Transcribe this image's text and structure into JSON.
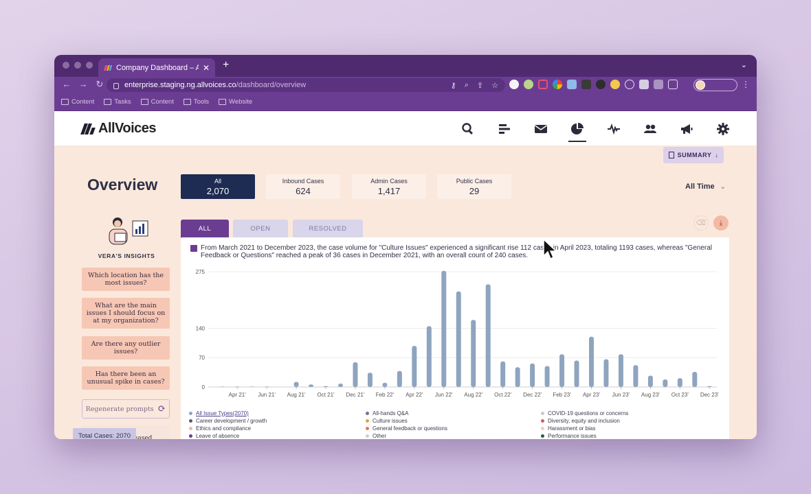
{
  "browser": {
    "tab_title": "Company Dashboard – AllVoices",
    "tab_close": "✕",
    "new_tab": "+",
    "url_host": "enterprise.staging.ng.allvoices.co",
    "url_path": "/dashboard/overview",
    "bookmarks": [
      "Content",
      "Tasks",
      "Content",
      "Tools",
      "Website"
    ]
  },
  "app": {
    "logo_text": "AllVoices",
    "summary_label": "SUMMARY",
    "page_title": "Overview",
    "stats": [
      {
        "label": "All",
        "value": "2,070"
      },
      {
        "label": "Inbound Cases",
        "value": "624"
      },
      {
        "label": "Admin Cases",
        "value": "1,417"
      },
      {
        "label": "Public Cases",
        "value": "29"
      }
    ],
    "time_filter": "All Time",
    "subtabs": [
      "ALL",
      "OPEN",
      "RESOLVED"
    ]
  },
  "insights": {
    "title": "VERA'S INSIGHTS",
    "prompts": [
      "Which location has the most issues?",
      "What are the main issues I should focus on at my organization?",
      "Are there any outlier issues?",
      "Has there been an unusual spike in cases?"
    ],
    "regenerate_label": "Regenerate prompts",
    "partial_prompt": "Has it decreased",
    "total_badge": "Total Cases: 2070"
  },
  "chart_panel": {
    "insight_text": "From March 2021 to December 2023, the case volume for \"Culture Issues\" experienced a significant rise 112 cases in April 2023, totaling 1193 cases, whereas \"General Feedback or Questions\" reached a peak of 36 cases in December 2021, with an overall count of 240 cases."
  },
  "chart_data": {
    "type": "bar",
    "ylim": [
      0,
      275
    ],
    "yticks": [
      0,
      70,
      140,
      275
    ],
    "x_tick_labels": [
      "Apr 21'",
      "Jun 21'",
      "Aug 21'",
      "Oct 21'",
      "Dec 21'",
      "Feb 22'",
      "Apr 22'",
      "Jun 22'",
      "Aug 22'",
      "Oct 22'",
      "Dec 22'",
      "Feb 23'",
      "Apr 23'",
      "Jun 23'",
      "Aug 23'",
      "Oct 23'",
      "Dec 23'"
    ],
    "months": [
      "Mar 21'",
      "Apr 21'",
      "May 21'",
      "Jun 21'",
      "Jul 21'",
      "Aug 21'",
      "Sep 21'",
      "Oct 21'",
      "Nov 21'",
      "Dec 21'",
      "Jan 22'",
      "Feb 22'",
      "Mar 22'",
      "Apr 22'",
      "May 22'",
      "Jun 22'",
      "Jul 22'",
      "Aug 22'",
      "Sep 22'",
      "Oct 22'",
      "Nov 22'",
      "Dec 22'",
      "Jan 23'",
      "Feb 23'",
      "Mar 23'",
      "Apr 23'",
      "May 23'",
      "Jun 23'",
      "Jul 23'",
      "Aug 23'",
      "Sep 23'",
      "Oct 23'",
      "Nov 23'",
      "Dec 23'"
    ],
    "values": [
      1,
      1,
      1,
      1,
      0,
      12,
      6,
      2,
      8,
      59,
      34,
      10,
      38,
      98,
      145,
      277,
      228,
      160,
      245,
      61,
      47,
      56,
      50,
      78,
      63,
      120,
      66,
      78,
      52,
      27,
      18,
      21,
      36,
      2
    ],
    "series_name": "All Issue Types(2070)",
    "bar_color": "#8ea4bf",
    "grid": true
  },
  "legend": [
    {
      "label": "All Issue Types(2070)",
      "color": "#8ea4bf"
    },
    {
      "label": "All-hands Q&A",
      "color": "#6f7590"
    },
    {
      "label": "COVID-19 questions or concerns",
      "color": "#c9c9c9"
    },
    {
      "label": "Career development / growth",
      "color": "#555a70"
    },
    {
      "label": "Culture issues",
      "color": "#e3a24a"
    },
    {
      "label": "Diversity, equity and inclusion",
      "color": "#d95c5c"
    },
    {
      "label": "Ethics and compliance",
      "color": "#f0b5a8"
    },
    {
      "label": "General feedback or questions",
      "color": "#e07b54"
    },
    {
      "label": "Harassment or bias",
      "color": "#f3c9c0"
    },
    {
      "label": "Leave of absence",
      "color": "#6b3d92"
    },
    {
      "label": "Other",
      "color": "#cfcfcf"
    },
    {
      "label": "Performance issues",
      "color": "#2e5a4b"
    }
  ]
}
